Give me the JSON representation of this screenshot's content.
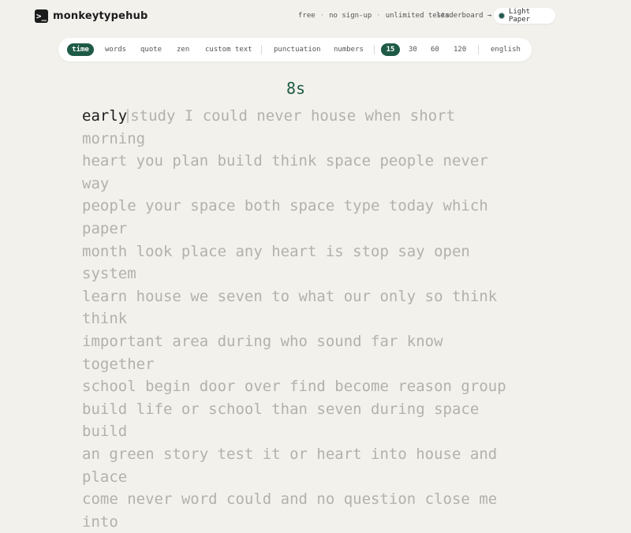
{
  "header": {
    "logo_glyph": ">_",
    "brand": "monkeytypehub",
    "tagline": [
      "free",
      "no sign-up",
      "unlimited tests"
    ],
    "tagline_sep": "·",
    "leaderboard": "leaderboard →",
    "theme": "Light Paper"
  },
  "config": {
    "modes": [
      "time",
      "words",
      "quote",
      "zen",
      "custom text"
    ],
    "active_mode": "time",
    "toggles": [
      "punctuation",
      "numbers"
    ],
    "durations": [
      "15",
      "30",
      "60",
      "120"
    ],
    "active_duration": "15",
    "language": "english"
  },
  "test": {
    "timer": "8s",
    "current_word": "early",
    "lines": [
      "study I could never house when short morning",
      "heart you plan build think space people never way",
      "people your space both space type today which paper",
      "month look place any heart is stop say open system",
      "learn house we seven to what our only so think think",
      "important area during who sound far know together",
      "school begin door over find become reason group",
      "build life or school than seven during space build",
      "an green story test it or heart into house and place",
      "come never word could and no question close me into"
    ]
  },
  "colors": {
    "accent": "#1e5a46",
    "background": "#f2f1ec",
    "untyped": "#b2b1ab"
  }
}
